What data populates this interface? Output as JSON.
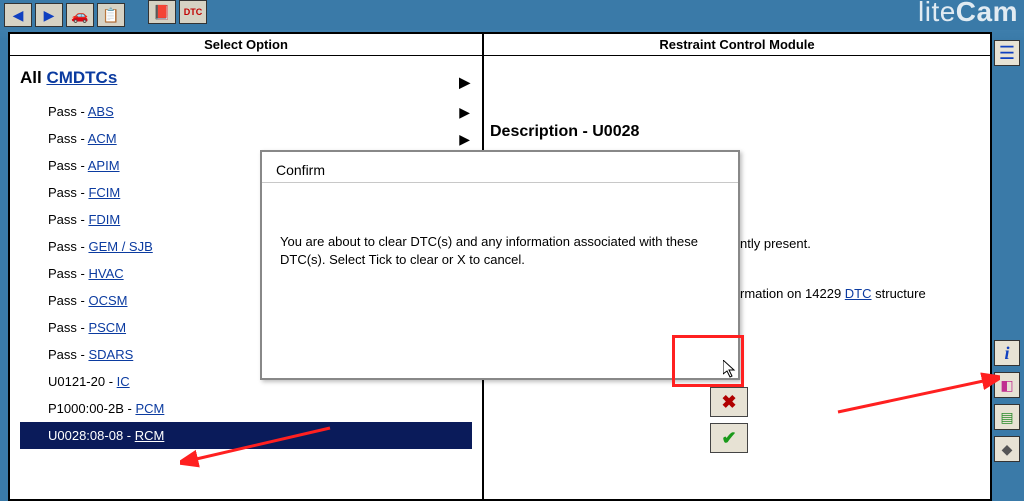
{
  "watermark": {
    "lite": "lite",
    "cam": "Cam"
  },
  "left": {
    "header": "Select Option",
    "main_prefix": "All ",
    "main_link": "CMDTCs",
    "items": [
      {
        "prefix": "Pass - ",
        "link": "ABS",
        "arrow": true
      },
      {
        "prefix": "Pass - ",
        "link": "ACM",
        "arrow": true
      },
      {
        "prefix": "Pass - ",
        "link": "APIM",
        "arrow": true
      },
      {
        "prefix": "Pass - ",
        "link": "FCIM",
        "arrow": true
      },
      {
        "prefix": "Pass - ",
        "link": "FDIM",
        "arrow": true
      },
      {
        "prefix": "Pass - ",
        "link": "GEM / SJB",
        "arrow": true
      },
      {
        "prefix": "Pass - ",
        "link": "HVAC",
        "arrow": true
      },
      {
        "prefix": "Pass - ",
        "link": "OCSM",
        "arrow": true
      },
      {
        "prefix": "Pass - ",
        "link": "PSCM",
        "arrow": true
      },
      {
        "prefix": "Pass - ",
        "link": "SDARS",
        "arrow": true
      },
      {
        "prefix": "U0121-20 - ",
        "link": "IC",
        "arrow": false
      },
      {
        "prefix": "P1000:00-2B - ",
        "link": "PCM",
        "arrow": false
      },
      {
        "prefix": "U0028:08-08 - ",
        "link": "RCM",
        "arrow": false,
        "selected": true
      }
    ]
  },
  "right": {
    "header": "Restraint Control Module",
    "desc_title": "Description - U0028",
    "present_fragment": "ntly present.",
    "struct_fragment_pre": "rmation on 14229 ",
    "struct_link": "DTC",
    "struct_fragment_post": " structure"
  },
  "dialog": {
    "title": "Confirm",
    "body_pre": "You are about to clear ",
    "body_link1": "DTC",
    "body_mid1": "(s) and any information associated with these ",
    "body_link2": "DTC",
    "body_mid2": "(s). Select Tick to clear or X to cancel."
  },
  "icons": {
    "back": "◀",
    "forward": "▶",
    "vehicle": "🚗",
    "doc": "📋",
    "book": "📕",
    "dtc": "DTC",
    "list": "☰",
    "info": "i",
    "eraser": "◧",
    "page": "▤",
    "gear": "◆",
    "cancel": "✖",
    "confirm": "✔"
  }
}
